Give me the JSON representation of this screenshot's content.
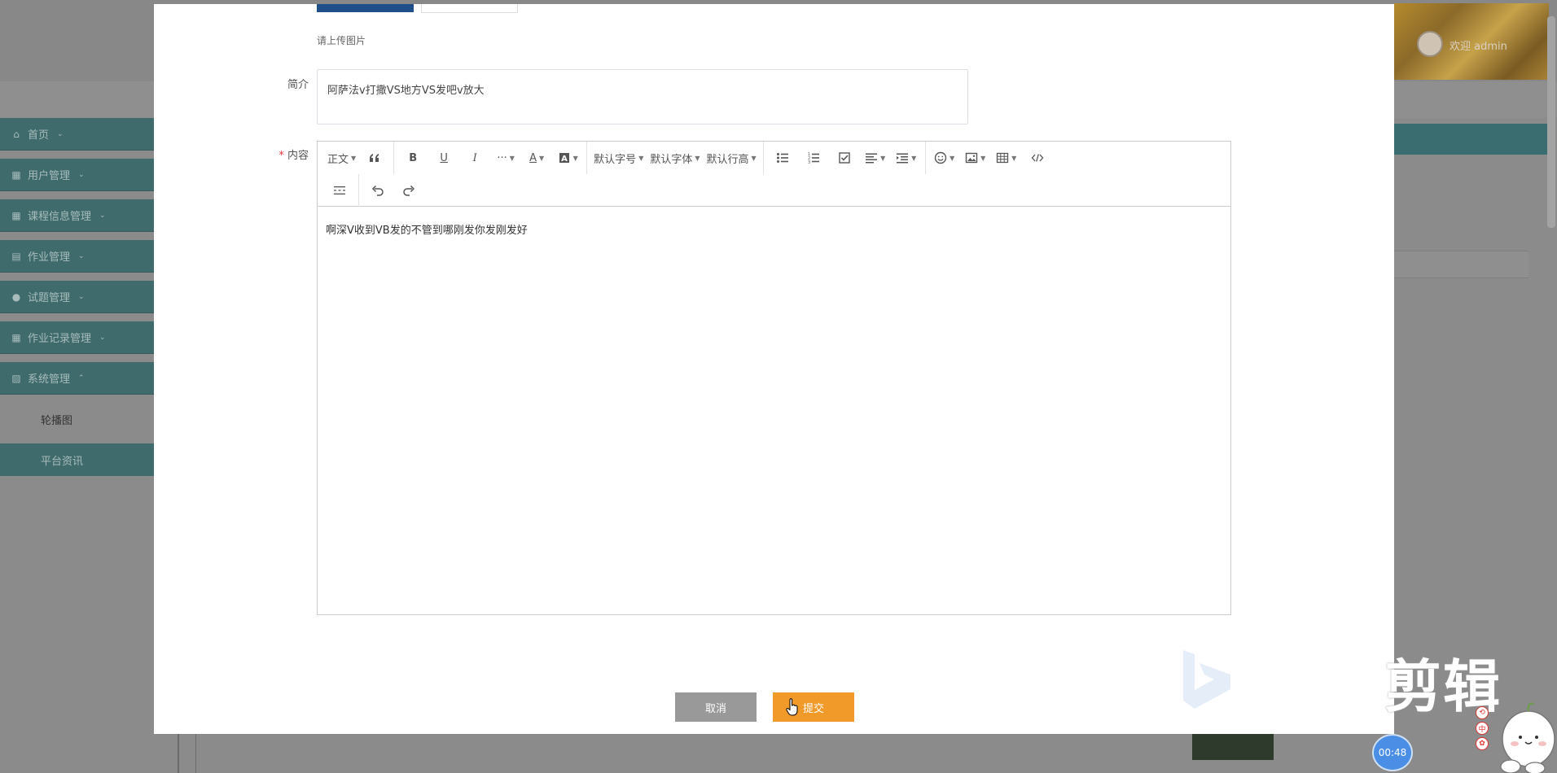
{
  "header": {
    "welcome": "欢迎 admin"
  },
  "sidebar": {
    "items": [
      {
        "label": "首页",
        "icon": "home-icon"
      },
      {
        "label": "用户管理",
        "icon": "user-icon"
      },
      {
        "label": "课程信息管理",
        "icon": "grid-icon"
      },
      {
        "label": "作业管理",
        "icon": "book-icon"
      },
      {
        "label": "试题管理",
        "icon": "check-circle-icon"
      },
      {
        "label": "作业记录管理",
        "icon": "grid-icon"
      },
      {
        "label": "系统管理",
        "icon": "settings-icon"
      }
    ],
    "subitems": [
      {
        "label": "轮播图"
      },
      {
        "label": "平台资讯"
      }
    ]
  },
  "form": {
    "upload_hint": "请上传图片",
    "intro_label": "简介",
    "intro_value": "阿萨法v打撒VS地方VS发吧v放大",
    "content_label": "内容",
    "required_mark": "*",
    "content_value": "啊深V收到VB发的不管到哪刚发你发刚发好",
    "cancel_label": "取消",
    "submit_label": "提交"
  },
  "toolbar": {
    "paragraph": "正文",
    "font_size": "默认字号",
    "font_family": "默认字体",
    "line_height": "默认行高",
    "more": "···"
  },
  "overlay": {
    "watermark": "剪辑",
    "timer": "00:48"
  },
  "colors": {
    "sidebar_teal": "#3f6b6c",
    "submit_orange": "#f19a2a",
    "cancel_gray": "#999999",
    "required_red": "#e4393c"
  }
}
